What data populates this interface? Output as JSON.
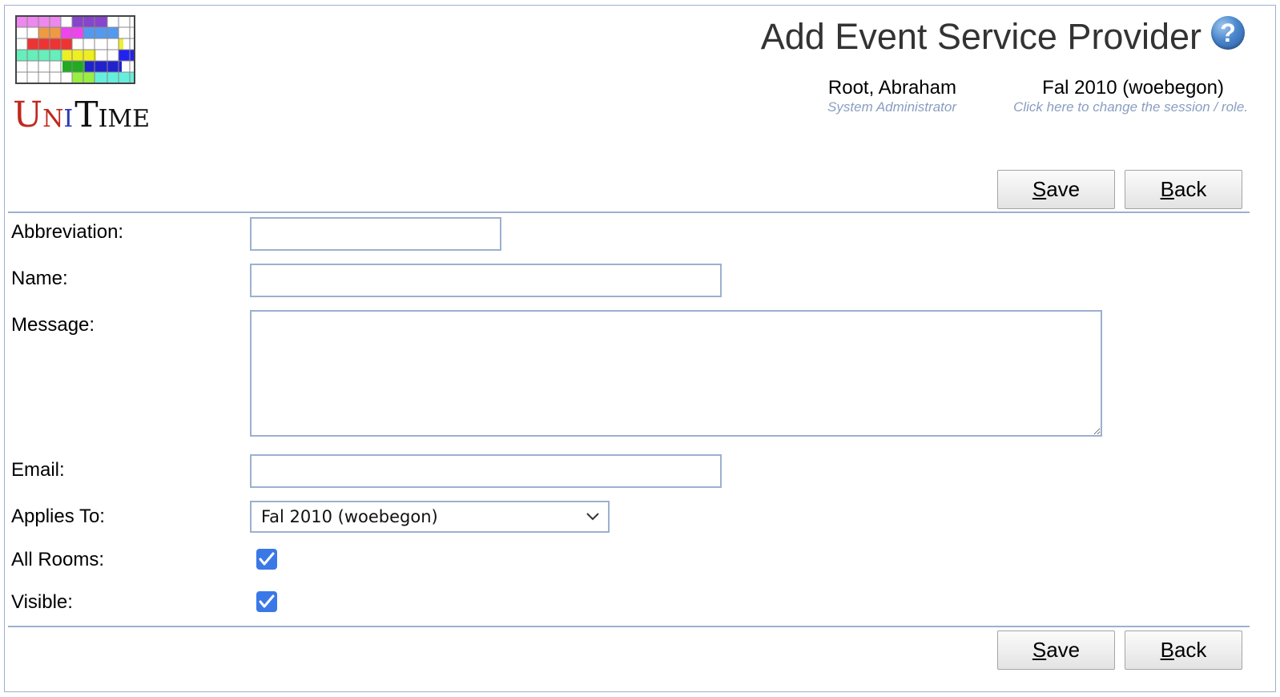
{
  "app": {
    "logo_letters": [
      "U",
      "N",
      "I",
      "T",
      "IME"
    ],
    "logo_alt": "UniTime"
  },
  "header": {
    "title": "Add Event Service Provider",
    "help_icon": "help-icon",
    "help_glyph": "?",
    "user_name": "Root, Abraham",
    "user_role": "System Administrator",
    "session_name": "Fal 2010 (woebegon)",
    "session_hint": "Click here to change the session / role."
  },
  "toolbar": {
    "save_accesskey": "S",
    "save_rest": "ave",
    "back_accesskey": "B",
    "back_rest": "ack"
  },
  "form": {
    "abbreviation_label": "Abbreviation:",
    "abbreviation_value": "",
    "name_label": "Name:",
    "name_value": "",
    "message_label": "Message:",
    "message_value": "",
    "email_label": "Email:",
    "email_value": "",
    "applies_to_label": "Applies To:",
    "applies_to_selected": "Fal 2010 (woebegon)",
    "all_rooms_label": "All Rooms:",
    "all_rooms_checked": true,
    "visible_label": "Visible:",
    "visible_checked": true
  },
  "colors": {
    "border": "#9cb0ce",
    "checkbox": "#3b78e7",
    "title": "#333333",
    "hint": "#8a9ec0"
  }
}
